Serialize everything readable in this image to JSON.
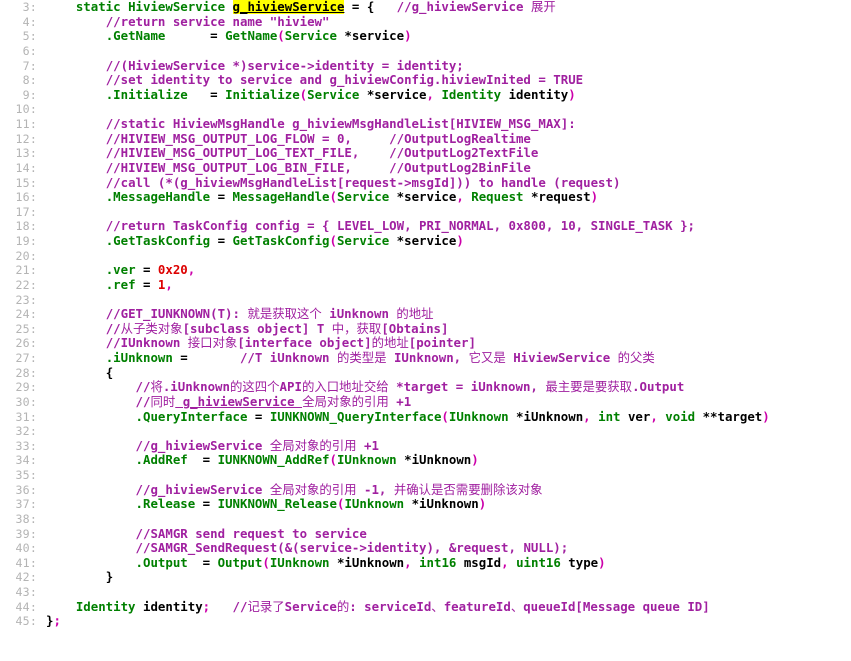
{
  "editor": {
    "name": "code-listing",
    "language": "c",
    "gutter_separator": ":",
    "colors": {
      "background": "#ffffff",
      "line_number": "#b4b4b4",
      "keyword": "#008000",
      "comment": "#a020a0",
      "plain": "#000000",
      "punctuation": "#cc00aa",
      "number": "#dd0000",
      "highlight_background": "#ffff00",
      "highlight_text": "#000000"
    },
    "first_line_number": 3,
    "last_line_number": 45,
    "highlighted_token": "g_hiviewService"
  },
  "lines": [
    {
      "number": "3:",
      "text": "    static HiviewService g_hiviewService = {   //g_hiviewService 展开",
      "tokens": [
        {
          "t": "    ",
          "c": "pl"
        },
        {
          "t": "static",
          "c": "kw"
        },
        {
          "t": " ",
          "c": "pl"
        },
        {
          "t": "HiviewService",
          "c": "kw"
        },
        {
          "t": " ",
          "c": "pl"
        },
        {
          "t": "g_hiviewService",
          "c": "hl"
        },
        {
          "t": " = {   ",
          "c": "pl"
        },
        {
          "t": "//g_hiviewService ",
          "c": "cm"
        },
        {
          "t": "展开",
          "c": "cm-cjk"
        }
      ]
    },
    {
      "number": "4:",
      "text": "        //return service name \"hiview\"",
      "tokens": [
        {
          "t": "        ",
          "c": "pl"
        },
        {
          "t": "//return service name \"hiview\"",
          "c": "cm"
        }
      ]
    },
    {
      "number": "5:",
      "text": "        .GetName      = GetName(Service *service)",
      "tokens": [
        {
          "t": "        ",
          "c": "pl"
        },
        {
          "t": ".GetName",
          "c": "kw"
        },
        {
          "t": "      ",
          "c": "pl"
        },
        {
          "t": "= ",
          "c": "pl"
        },
        {
          "t": "GetName",
          "c": "kw"
        },
        {
          "t": "(",
          "c": "pn"
        },
        {
          "t": "Service",
          "c": "kw"
        },
        {
          "t": " *service",
          "c": "pl"
        },
        {
          "t": ")",
          "c": "pn"
        }
      ]
    },
    {
      "number": "6:",
      "text": "",
      "tokens": []
    },
    {
      "number": "7:",
      "text": "        //(HiviewService *)service->identity = identity;",
      "tokens": [
        {
          "t": "        ",
          "c": "pl"
        },
        {
          "t": "//(HiviewService *)service->identity = identity;",
          "c": "cm"
        }
      ]
    },
    {
      "number": "8:",
      "text": "        //set identity to service and g_hiviewConfig.hiviewInited = TRUE",
      "tokens": [
        {
          "t": "        ",
          "c": "pl"
        },
        {
          "t": "//set identity to service and g_hiviewConfig.hiviewInited = TRUE",
          "c": "cm"
        }
      ]
    },
    {
      "number": "9:",
      "text": "        .Initialize   = Initialize(Service *service, Identity identity)",
      "tokens": [
        {
          "t": "        ",
          "c": "pl"
        },
        {
          "t": ".Initialize",
          "c": "kw"
        },
        {
          "t": "   ",
          "c": "pl"
        },
        {
          "t": "= ",
          "c": "pl"
        },
        {
          "t": "Initialize",
          "c": "kw"
        },
        {
          "t": "(",
          "c": "pn"
        },
        {
          "t": "Service",
          "c": "kw"
        },
        {
          "t": " *service",
          "c": "pl"
        },
        {
          "t": ",",
          "c": "pn"
        },
        {
          "t": " ",
          "c": "pl"
        },
        {
          "t": "Identity",
          "c": "kw"
        },
        {
          "t": " identity",
          "c": "pl"
        },
        {
          "t": ")",
          "c": "pn"
        }
      ]
    },
    {
      "number": "10:",
      "text": "",
      "tokens": []
    },
    {
      "number": "11:",
      "text": "        //static HiviewMsgHandle g_hiviewMsgHandleList[HIVIEW_MSG_MAX]:",
      "tokens": [
        {
          "t": "        ",
          "c": "pl"
        },
        {
          "t": "//static HiviewMsgHandle g_hiviewMsgHandleList[HIVIEW_MSG_MAX]:",
          "c": "cm"
        }
      ]
    },
    {
      "number": "12:",
      "text": "        //HIVIEW_MSG_OUTPUT_LOG_FLOW = 0,     //OutputLogRealtime",
      "tokens": [
        {
          "t": "        ",
          "c": "pl"
        },
        {
          "t": "//HIVIEW_MSG_OUTPUT_LOG_FLOW = 0,     //OutputLogRealtime",
          "c": "cm"
        }
      ]
    },
    {
      "number": "13:",
      "text": "        //HIVIEW_MSG_OUTPUT_LOG_TEXT_FILE,    //OutputLog2TextFile",
      "tokens": [
        {
          "t": "        ",
          "c": "pl"
        },
        {
          "t": "//HIVIEW_MSG_OUTPUT_LOG_TEXT_FILE,    //OutputLog2TextFile",
          "c": "cm"
        }
      ]
    },
    {
      "number": "14:",
      "text": "        //HIVIEW_MSG_OUTPUT_LOG_BIN_FILE,     //OutputLog2BinFile",
      "tokens": [
        {
          "t": "        ",
          "c": "pl"
        },
        {
          "t": "//HIVIEW_MSG_OUTPUT_LOG_BIN_FILE,     //OutputLog2BinFile",
          "c": "cm"
        }
      ]
    },
    {
      "number": "15:",
      "text": "        //call (*(g_hiviewMsgHandleList[request->msgId])) to handle (request)",
      "tokens": [
        {
          "t": "        ",
          "c": "pl"
        },
        {
          "t": "//call (*(g_hiviewMsgHandleList[request->msgId])) to handle (request)",
          "c": "cm"
        }
      ]
    },
    {
      "number": "16:",
      "text": "        .MessageHandle = MessageHandle(Service *service, Request *request)",
      "tokens": [
        {
          "t": "        ",
          "c": "pl"
        },
        {
          "t": ".MessageHandle",
          "c": "kw"
        },
        {
          "t": " = ",
          "c": "pl"
        },
        {
          "t": "MessageHandle",
          "c": "kw"
        },
        {
          "t": "(",
          "c": "pn"
        },
        {
          "t": "Service",
          "c": "kw"
        },
        {
          "t": " *service",
          "c": "pl"
        },
        {
          "t": ",",
          "c": "pn"
        },
        {
          "t": " ",
          "c": "pl"
        },
        {
          "t": "Request",
          "c": "kw"
        },
        {
          "t": " *request",
          "c": "pl"
        },
        {
          "t": ")",
          "c": "pn"
        }
      ]
    },
    {
      "number": "17:",
      "text": "",
      "tokens": []
    },
    {
      "number": "18:",
      "text": "        //return TaskConfig config = { LEVEL_LOW, PRI_NORMAL, 0x800, 10, SINGLE_TASK };",
      "tokens": [
        {
          "t": "        ",
          "c": "pl"
        },
        {
          "t": "//return TaskConfig config = { LEVEL_LOW, PRI_NORMAL, 0x800, 10, SINGLE_TASK };",
          "c": "cm"
        }
      ]
    },
    {
      "number": "19:",
      "text": "        .GetTaskConfig = GetTaskConfig(Service *service)",
      "tokens": [
        {
          "t": "        ",
          "c": "pl"
        },
        {
          "t": ".GetTaskConfig",
          "c": "kw"
        },
        {
          "t": " = ",
          "c": "pl"
        },
        {
          "t": "GetTaskConfig",
          "c": "kw"
        },
        {
          "t": "(",
          "c": "pn"
        },
        {
          "t": "Service",
          "c": "kw"
        },
        {
          "t": " *service",
          "c": "pl"
        },
        {
          "t": ")",
          "c": "pn"
        }
      ]
    },
    {
      "number": "20:",
      "text": "",
      "tokens": []
    },
    {
      "number": "21:",
      "text": "        .ver = 0x20,",
      "tokens": [
        {
          "t": "        ",
          "c": "pl"
        },
        {
          "t": ".ver",
          "c": "kw"
        },
        {
          "t": " = ",
          "c": "pl"
        },
        {
          "t": "0x20",
          "c": "num"
        },
        {
          "t": ",",
          "c": "pn"
        }
      ]
    },
    {
      "number": "22:",
      "text": "        .ref = 1,",
      "tokens": [
        {
          "t": "        ",
          "c": "pl"
        },
        {
          "t": ".ref",
          "c": "kw"
        },
        {
          "t": " = ",
          "c": "pl"
        },
        {
          "t": "1",
          "c": "num"
        },
        {
          "t": ",",
          "c": "pn"
        }
      ]
    },
    {
      "number": "23:",
      "text": "",
      "tokens": []
    },
    {
      "number": "24:",
      "text": "        //GET_IUNKNOWN(T): 就是获取这个 iUnknown 的地址",
      "tokens": [
        {
          "t": "        ",
          "c": "pl"
        },
        {
          "t": "//GET_IUNKNOWN(T)",
          "c": "cm"
        },
        {
          "t": ": ",
          "c": "cm"
        },
        {
          "t": "就是获取这个",
          "c": "cm-cjk"
        },
        {
          "t": " iUnknown ",
          "c": "cm"
        },
        {
          "t": "的地址",
          "c": "cm-cjk"
        }
      ]
    },
    {
      "number": "25:",
      "text": "        //从子类对象[subclass object] T 中，获取[Obtains]",
      "tokens": [
        {
          "t": "        ",
          "c": "pl"
        },
        {
          "t": "//",
          "c": "cm"
        },
        {
          "t": "从子类对象",
          "c": "cm-cjk"
        },
        {
          "t": "[subclass object] T ",
          "c": "cm"
        },
        {
          "t": "中，获取",
          "c": "cm-cjk"
        },
        {
          "t": "[Obtains]",
          "c": "cm"
        }
      ]
    },
    {
      "number": "26:",
      "text": "        //IUnknown 接口对象[interface object]的地址[pointer]",
      "tokens": [
        {
          "t": "        ",
          "c": "pl"
        },
        {
          "t": "//IUnknown ",
          "c": "cm"
        },
        {
          "t": "接口对象",
          "c": "cm-cjk"
        },
        {
          "t": "[interface object]",
          "c": "cm"
        },
        {
          "t": "的地址",
          "c": "cm-cjk"
        },
        {
          "t": "[pointer]",
          "c": "cm"
        }
      ]
    },
    {
      "number": "27:",
      "text": "        .iUnknown =      //T iUnknown 的类型是 IUnknown, 它又是 HiviewService 的父类",
      "tokens": [
        {
          "t": "        ",
          "c": "pl"
        },
        {
          "t": ".iUnknown",
          "c": "kw"
        },
        {
          "t": " =       ",
          "c": "pl"
        },
        {
          "t": "//T iUnknown ",
          "c": "cm"
        },
        {
          "t": "的类型是",
          "c": "cm-cjk"
        },
        {
          "t": " IUnknown, ",
          "c": "cm"
        },
        {
          "t": "它又是",
          "c": "cm-cjk"
        },
        {
          "t": " HiviewService ",
          "c": "cm"
        },
        {
          "t": "的父类",
          "c": "cm-cjk"
        }
      ]
    },
    {
      "number": "28:",
      "text": "        {",
      "tokens": [
        {
          "t": "        ",
          "c": "pl"
        },
        {
          "t": "{",
          "c": "pl"
        }
      ]
    },
    {
      "number": "29:",
      "text": "            //将.iUnknown的这四个API的入口地址交给 *target = iUnknown, 最主要是要获取.Output",
      "tokens": [
        {
          "t": "            ",
          "c": "pl"
        },
        {
          "t": "//",
          "c": "cm"
        },
        {
          "t": "将",
          "c": "cm-cjk"
        },
        {
          "t": ".iUnknown",
          "c": "cm"
        },
        {
          "t": "的这四个",
          "c": "cm-cjk"
        },
        {
          "t": "API",
          "c": "cm"
        },
        {
          "t": "的入口地址交给",
          "c": "cm-cjk"
        },
        {
          "t": " *target = iUnknown, ",
          "c": "cm"
        },
        {
          "t": "最主要是要获取",
          "c": "cm-cjk"
        },
        {
          "t": ".Output",
          "c": "cm"
        }
      ]
    },
    {
      "number": "30:",
      "text": "            //同时 g_hiviewService 全局对象的引用 +1",
      "tokens": [
        {
          "t": "            ",
          "c": "pl"
        },
        {
          "t": "//",
          "c": "cm"
        },
        {
          "t": "同时",
          "c": "cm-cjk"
        },
        {
          "t": " g_hiviewService ",
          "c": "cm-ul"
        },
        {
          "t": "全局对象的引用",
          "c": "cm-cjk"
        },
        {
          "t": " +1",
          "c": "cm"
        }
      ]
    },
    {
      "number": "31:",
      "text": "            .QueryInterface = IUNKNOWN_QueryInterface(IUnknown *iUnknown, int ver, void **target)",
      "tokens": [
        {
          "t": "            ",
          "c": "pl"
        },
        {
          "t": ".QueryInterface",
          "c": "kw"
        },
        {
          "t": " = ",
          "c": "pl"
        },
        {
          "t": "IUNKNOWN_QueryInterface",
          "c": "kw"
        },
        {
          "t": "(",
          "c": "pn"
        },
        {
          "t": "IUnknown",
          "c": "kw"
        },
        {
          "t": " *iUnknown",
          "c": "pl"
        },
        {
          "t": ",",
          "c": "pn"
        },
        {
          "t": " ",
          "c": "pl"
        },
        {
          "t": "int",
          "c": "kw"
        },
        {
          "t": " ver",
          "c": "pl"
        },
        {
          "t": ",",
          "c": "pn"
        },
        {
          "t": " ",
          "c": "pl"
        },
        {
          "t": "void",
          "c": "kw"
        },
        {
          "t": " **target",
          "c": "pl"
        },
        {
          "t": ")",
          "c": "pn"
        }
      ]
    },
    {
      "number": "32:",
      "text": "",
      "tokens": []
    },
    {
      "number": "33:",
      "text": "            //g_hiviewService 全局对象的引用 +1",
      "tokens": [
        {
          "t": "            ",
          "c": "pl"
        },
        {
          "t": "//g_hiviewService ",
          "c": "cm"
        },
        {
          "t": "全局对象的引用",
          "c": "cm-cjk"
        },
        {
          "t": " +1",
          "c": "cm"
        }
      ]
    },
    {
      "number": "34:",
      "text": "            .AddRef = IUNKNOWN_AddRef(IUnknown *iUnknown)",
      "tokens": [
        {
          "t": "            ",
          "c": "pl"
        },
        {
          "t": ".AddRef",
          "c": "kw"
        },
        {
          "t": "  = ",
          "c": "pl"
        },
        {
          "t": "IUNKNOWN_AddRef",
          "c": "kw"
        },
        {
          "t": "(",
          "c": "pn"
        },
        {
          "t": "IUnknown",
          "c": "kw"
        },
        {
          "t": " *iUnknown",
          "c": "pl"
        },
        {
          "t": ")",
          "c": "pn"
        }
      ]
    },
    {
      "number": "35:",
      "text": "",
      "tokens": []
    },
    {
      "number": "36:",
      "text": "            //g_hiviewService 全局对象的引用 -1, 并确认是否需要删除该对象",
      "tokens": [
        {
          "t": "            ",
          "c": "pl"
        },
        {
          "t": "//g_hiviewService ",
          "c": "cm"
        },
        {
          "t": "全局对象的引用",
          "c": "cm-cjk"
        },
        {
          "t": " -1, ",
          "c": "cm"
        },
        {
          "t": "并确认是否需要删除该对象",
          "c": "cm-cjk"
        }
      ]
    },
    {
      "number": "37:",
      "text": "            .Release = IUNKNOWN_Release(IUnknown *iUnknown)",
      "tokens": [
        {
          "t": "            ",
          "c": "pl"
        },
        {
          "t": ".Release",
          "c": "kw"
        },
        {
          "t": " = ",
          "c": "pl"
        },
        {
          "t": "IUNKNOWN_Release",
          "c": "kw"
        },
        {
          "t": "(",
          "c": "pn"
        },
        {
          "t": "IUnknown",
          "c": "kw"
        },
        {
          "t": " *iUnknown",
          "c": "pl"
        },
        {
          "t": ")",
          "c": "pn"
        }
      ]
    },
    {
      "number": "38:",
      "text": "",
      "tokens": []
    },
    {
      "number": "39:",
      "text": "            //SAMGR send request to service",
      "tokens": [
        {
          "t": "            ",
          "c": "pl"
        },
        {
          "t": "//SAMGR send request to service",
          "c": "cm"
        }
      ]
    },
    {
      "number": "40:",
      "text": "            //SAMGR_SendRequest(&(service->identity), &request, NULL);",
      "tokens": [
        {
          "t": "            ",
          "c": "pl"
        },
        {
          "t": "//SAMGR_SendRequest(&(service->identity), &request, NULL);",
          "c": "cm"
        }
      ]
    },
    {
      "number": "41:",
      "text": "            .Output  = Output(IUnknown *iUnknown, int16 msgId, uint16 type)",
      "tokens": [
        {
          "t": "            ",
          "c": "pl"
        },
        {
          "t": ".Output",
          "c": "kw"
        },
        {
          "t": "  = ",
          "c": "pl"
        },
        {
          "t": "Output",
          "c": "kw"
        },
        {
          "t": "(",
          "c": "pn"
        },
        {
          "t": "IUnknown",
          "c": "kw"
        },
        {
          "t": " *iUnknown",
          "c": "pl"
        },
        {
          "t": ",",
          "c": "pn"
        },
        {
          "t": " ",
          "c": "pl"
        },
        {
          "t": "int16",
          "c": "kw"
        },
        {
          "t": " msgId",
          "c": "pl"
        },
        {
          "t": ",",
          "c": "pn"
        },
        {
          "t": " ",
          "c": "pl"
        },
        {
          "t": "uint16",
          "c": "kw"
        },
        {
          "t": " type",
          "c": "pl"
        },
        {
          "t": ")",
          "c": "pn"
        }
      ]
    },
    {
      "number": "42:",
      "text": "        }",
      "tokens": [
        {
          "t": "        ",
          "c": "pl"
        },
        {
          "t": "}",
          "c": "pl"
        }
      ]
    },
    {
      "number": "43:",
      "text": "",
      "tokens": []
    },
    {
      "number": "44:",
      "text": "    Identity identity;   //记录了Service的: serviceId、featureId、queueId[Message queue ID]",
      "tokens": [
        {
          "t": "    ",
          "c": "pl"
        },
        {
          "t": "Identity",
          "c": "kw"
        },
        {
          "t": " identity",
          "c": "pl"
        },
        {
          "t": ";",
          "c": "pn"
        },
        {
          "t": "   ",
          "c": "pl"
        },
        {
          "t": "//",
          "c": "cm"
        },
        {
          "t": "记录了",
          "c": "cm-cjk"
        },
        {
          "t": "Service",
          "c": "cm"
        },
        {
          "t": "的",
          "c": "cm-cjk"
        },
        {
          "t": ": serviceId",
          "c": "cm"
        },
        {
          "t": "、",
          "c": "cm-cjk"
        },
        {
          "t": "featureId",
          "c": "cm"
        },
        {
          "t": "、",
          "c": "cm-cjk"
        },
        {
          "t": "queueId[Message queue ID]",
          "c": "cm"
        }
      ]
    },
    {
      "number": "45:",
      "text": "};",
      "tokens": [
        {
          "t": "}",
          "c": "pl"
        },
        {
          "t": ";",
          "c": "pn"
        }
      ]
    }
  ]
}
